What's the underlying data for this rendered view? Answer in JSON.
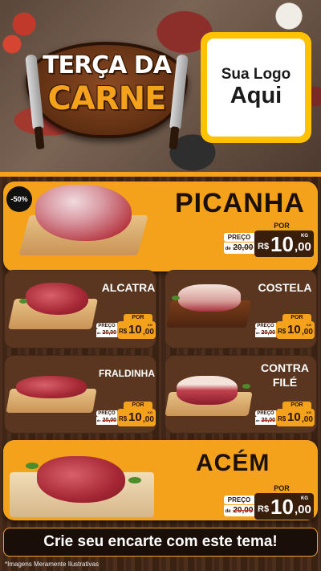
{
  "header": {
    "badge_line1": "TERÇA DA",
    "badge_line2": "CARNE",
    "logo_line1": "Sua Logo",
    "logo_line2": "Aqui"
  },
  "colors": {
    "accent": "#f4a21b",
    "wood": "#4a2d1c",
    "dark": "#3a1e0c"
  },
  "featured": {
    "name": "PICANHA",
    "discount": "-50%",
    "por": "POR",
    "preco": "PREÇO",
    "de": "de",
    "old_price": "20,00",
    "currency": "R$",
    "price_int": "10",
    "price_dec": ",00",
    "unit": "KG"
  },
  "items": [
    {
      "name": "ALCATRA",
      "por": "POR",
      "preco": "PREÇO",
      "de": "de",
      "old_price": "20,00",
      "currency": "R$",
      "price_int": "10",
      "price_dec": ",00",
      "unit": "KG"
    },
    {
      "name": "COSTELA",
      "por": "POR",
      "preco": "PREÇO",
      "de": "de",
      "old_price": "20,00",
      "currency": "R$",
      "price_int": "10",
      "price_dec": ",00",
      "unit": "KG"
    },
    {
      "name": "FRALDINHA",
      "por": "POR",
      "preco": "PREÇO",
      "de": "de",
      "old_price": "20,00",
      "currency": "R$",
      "price_int": "10",
      "price_dec": ",00",
      "unit": "KG"
    },
    {
      "name_line1": "CONTRA",
      "name_line2": "FILÉ",
      "por": "POR",
      "preco": "PREÇO",
      "de": "de",
      "old_price": "20,00",
      "currency": "R$",
      "price_int": "10",
      "price_dec": ",00",
      "unit": "KG"
    }
  ],
  "bottom": {
    "name": "ACÉM",
    "por": "POR",
    "preco": "PREÇO",
    "de": "de",
    "old_price": "20,00",
    "currency": "R$",
    "price_int": "10",
    "price_dec": ",00",
    "unit": "KG"
  },
  "cta": "Crie seu encarte com este tema!",
  "footnote": "*Imagens Meramente Ilustrativas"
}
